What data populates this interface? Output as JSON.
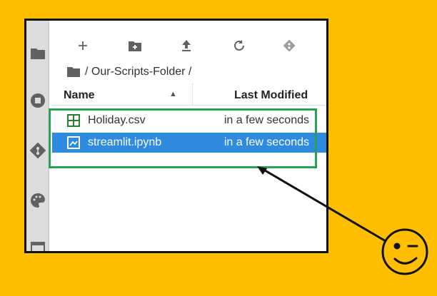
{
  "toolbar": {
    "buttons": [
      {
        "name": "new-launcher-button",
        "icon": "plus-icon"
      },
      {
        "name": "new-folder-button",
        "icon": "folder-plus-icon"
      },
      {
        "name": "upload-button",
        "icon": "upload-icon"
      },
      {
        "name": "refresh-button",
        "icon": "refresh-icon"
      },
      {
        "name": "git-clone-button",
        "icon": "git-clone-icon"
      }
    ]
  },
  "sidebar": {
    "items": [
      {
        "name": "file-browser-tab",
        "icon": "folder-icon"
      },
      {
        "name": "running-tab",
        "icon": "stop-circle-icon"
      },
      {
        "name": "git-tab",
        "icon": "git-icon"
      },
      {
        "name": "commands-tab",
        "icon": "palette-icon"
      },
      {
        "name": "tabs-tab",
        "icon": "tab-icon"
      }
    ]
  },
  "breadcrumb": {
    "text": "/ Our-Scripts-Folder /"
  },
  "file_list": {
    "headers": {
      "name": "Name",
      "last_modified": "Last Modified"
    },
    "sort_indicator": "▲",
    "rows": [
      {
        "name": "Holiday.csv",
        "modified": "in a few seconds",
        "icon": "spreadsheet-icon",
        "selected": false
      },
      {
        "name": "streamlit.ipynb",
        "modified": "in a few seconds",
        "icon": "notebook-icon",
        "selected": true
      }
    ]
  },
  "colors": {
    "background": "#FFBE00",
    "selection": "#2f8be0",
    "highlight_box": "#2aa05a"
  }
}
